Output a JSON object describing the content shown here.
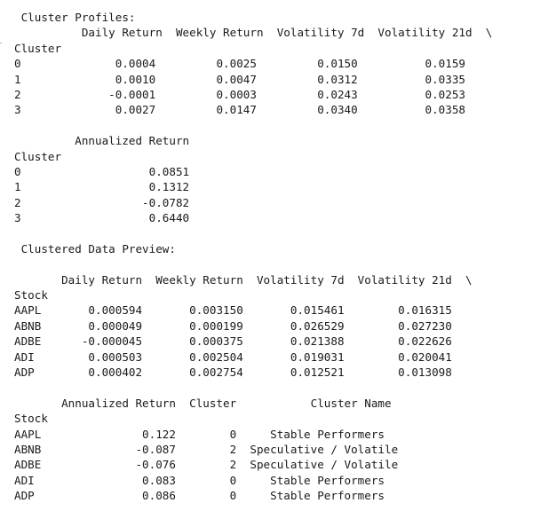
{
  "output": {
    "lines": [
      " Cluster Profiles:",
      "          Daily Return  Weekly Return  Volatility 7d  Volatility 21d  \\",
      "Cluster",
      "0              0.0004         0.0025         0.0150          0.0159",
      "1              0.0010         0.0047         0.0312          0.0335",
      "2             -0.0001         0.0003         0.0243          0.0253",
      "3              0.0027         0.0147         0.0340          0.0358",
      "",
      "         Annualized Return",
      "Cluster",
      "0                   0.0851",
      "1                   0.1312",
      "2                  -0.0782",
      "3                   0.6440",
      "",
      " Clustered Data Preview:",
      "",
      "       Daily Return  Weekly Return  Volatility 7d  Volatility 21d  \\",
      "Stock",
      "AAPL       0.000594       0.003150       0.015461        0.016315",
      "ABNB       0.000049       0.000199       0.026529        0.027230",
      "ADBE      -0.000045       0.000375       0.021388        0.022626",
      "ADI        0.000503       0.002504       0.019031        0.020041",
      "ADP        0.000402       0.002754       0.012521        0.013098",
      "",
      "       Annualized Return  Cluster           Cluster Name",
      "Stock",
      "AAPL               0.122        0     Stable Performers",
      "ABNB              -0.087        2  Speculative / Volatile",
      "ADBE              -0.076        2  Speculative / Volatile",
      "ADI                0.083        0     Stable Performers",
      "ADP                0.086        0     Stable Performers"
    ]
  }
}
